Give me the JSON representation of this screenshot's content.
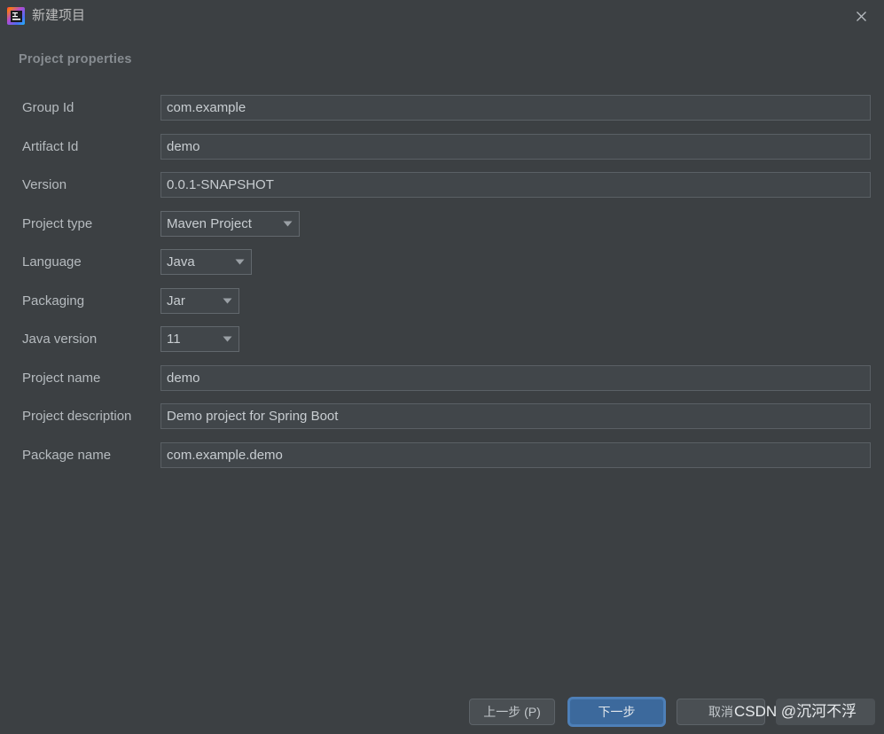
{
  "window": {
    "title": "新建项目",
    "app_icon": "intellij-idea-icon",
    "close_icon": "close-icon"
  },
  "section": {
    "header": "Project properties"
  },
  "form": {
    "rows": [
      {
        "label": "Group Id",
        "type": "text",
        "value": "com.example"
      },
      {
        "label": "Artifact Id",
        "type": "text",
        "value": "demo"
      },
      {
        "label": "Version",
        "type": "text",
        "value": "0.0.1-SNAPSHOT"
      },
      {
        "label": "Project type",
        "type": "combo",
        "value": "Maven Project"
      },
      {
        "label": "Language",
        "type": "combo",
        "value": "Java"
      },
      {
        "label": "Packaging",
        "type": "combo",
        "value": "Jar"
      },
      {
        "label": "Java version",
        "type": "combo",
        "value": "11"
      },
      {
        "label": "Project name",
        "type": "text",
        "value": "demo"
      },
      {
        "label": "Project description",
        "type": "text",
        "value": "Demo project for Spring Boot"
      },
      {
        "label": "Package name",
        "type": "text",
        "value": "com.example.demo"
      }
    ]
  },
  "footer": {
    "previous_label": "上一步 (P)",
    "next_label": "下一步",
    "cancel_label": "取消"
  },
  "watermark": {
    "text": "CSDN @沉河不浮"
  },
  "colors": {
    "background": "#3c4043",
    "field_background": "#41464a",
    "field_border": "#5a6065",
    "label_text": "#b6bbbf",
    "value_text": "#c8cdd1",
    "section_header": "#878c91",
    "accent_button": "#3c699c",
    "accent_focus_ring": "#4f80b8"
  }
}
